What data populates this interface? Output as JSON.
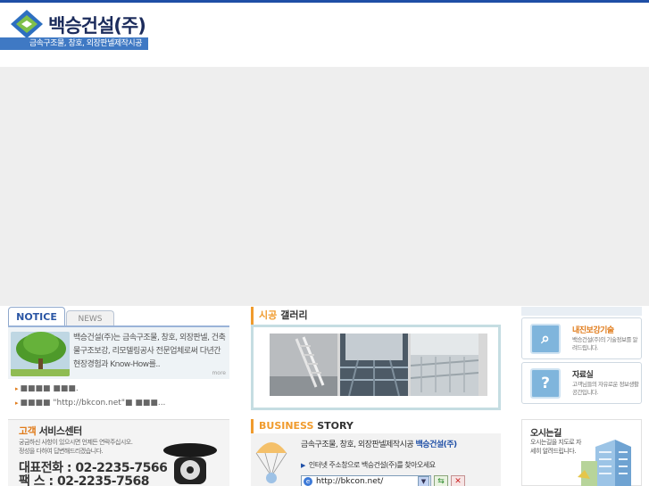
{
  "header": {
    "company_name": "백승건설(주)",
    "slogan": "금속구조물, 창호, 외장판넬제작시공"
  },
  "notice": {
    "tab_notice": "NOTICE",
    "tab_news": "NEWS",
    "intro": "백승건설(주)는 금속구조물, 창호, 외장판넬, 건축물구조보강, 리모델링공사 전문업체로써 다년간 현장경험과 Know-How를..",
    "more": "more",
    "items": [
      "■■■■ ■■■.",
      "■■■■ \"http://bkcon.net\"■ ■■■..."
    ]
  },
  "customer": {
    "title_highlight": "고객",
    "title_rest": "서비스센터",
    "desc_line1": "궁금하신 사항이 있으시면 언제든 연락주십시오.",
    "desc_line2": "정성을 다하여 답변해드리겠습니다.",
    "phone_line": "대표전화 : 02-2235-7566",
    "fax_line": "팩      스 : 02-2235-7568"
  },
  "gallery": {
    "title_highlight": "시공",
    "title_rest": "갤러리"
  },
  "story": {
    "title_highlight": "BUSINESS",
    "title_rest": "STORY",
    "headline_prefix": "금속구조물, 창호, 외장판넬제작시공",
    "headline_brand": "백승건설(주)",
    "instruction": "인터넷 주소창으로 백승건설(주)를 찾아오세요",
    "url": "http://bkcon.net/"
  },
  "side": {
    "tech": {
      "title": "내진보강기술",
      "desc": "백승건설(주)의 기술정보를 알려드립니다."
    },
    "data": {
      "title": "자료실",
      "desc": "고객님들의 자유로운 정보생활 공간입니다."
    },
    "map": {
      "title": "오시는길",
      "desc": "오시는길을 지도로 자세히 알려드립니다."
    }
  },
  "colors": {
    "brand_blue": "#1f4fa6",
    "accent_orange": "#f09b2d",
    "slogan_bg": "#3f79c4"
  }
}
